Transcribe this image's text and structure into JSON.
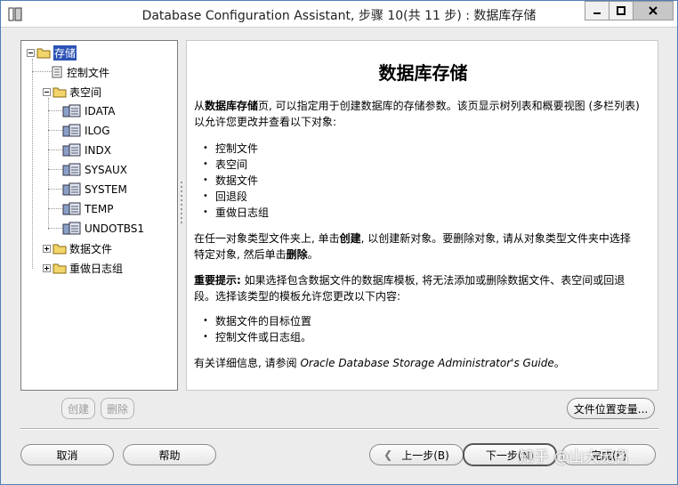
{
  "window": {
    "title": "Database Configuration Assistant, 步骤 10(共 11 步) : 数据库存储"
  },
  "tree": {
    "root": "存储",
    "control_files": "控制文件",
    "tablespaces": "表空间",
    "tablespace_items": [
      "IDATA",
      "ILOG",
      "INDX",
      "SYSAUX",
      "SYSTEM",
      "TEMP",
      "UNDOTBS1"
    ],
    "datafiles": "数据文件",
    "redo_log_groups": "重做日志组"
  },
  "content": {
    "heading": "数据库存储",
    "intro_prefix": "从",
    "intro_bold": "数据库存储",
    "intro_line1_rest": "页, 可以指定用于创建数据库的存储参数。该页显示树列表和概要视图 (多栏列表)",
    "intro_line2": "以允许您更改并查看以下对象:",
    "objects": [
      "控制文件",
      "表空间",
      "数据文件",
      "回退段",
      "重做日志组"
    ],
    "create_line1_a": "在任一对象类型文件夹上, 单击",
    "create_bold": "创建",
    "create_line1_b": ", 以创建新对象。要删除对象, 请从对象类型文件夹中选择",
    "create_line2_a": "特定对象, 然后单击",
    "delete_bold": "删除",
    "create_line2_b": "。",
    "important_bold": "重要提示:",
    "important_line1": " 如果选择包含数据文件的数据库模板, 将无法添加或删除数据文件、表空间或回退",
    "important_line2": "段。选择该类型的模板允许您更改以下内容:",
    "template_items": [
      "数据文件的目标位置",
      "控制文件或日志组。"
    ],
    "more_info_prefix": "有关详细信息, 请参阅 ",
    "more_info_guide": "Oracle Database Storage Administrator's Guide",
    "more_info_suffix": "。"
  },
  "buttons": {
    "create": "创建",
    "delete": "删除",
    "file_location_vars": "文件位置变量...",
    "cancel": "取消",
    "help": "帮助",
    "back": "上一步(B)",
    "next": "下一步(N)",
    "finish": "完成(F)"
  },
  "watermark": "知乎 @山大无名"
}
